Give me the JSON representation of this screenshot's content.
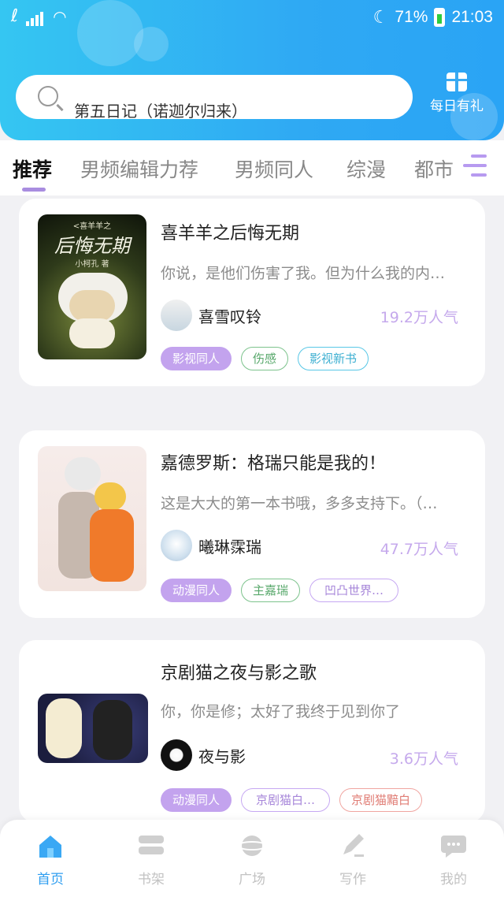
{
  "status_bar": {
    "battery": "71%",
    "time": "21:03"
  },
  "search": {
    "placeholder": "第五日记（诺迦尔归来）"
  },
  "daily_gift": {
    "label": "每日有礼"
  },
  "tabs": [
    {
      "label": "推荐",
      "active": true
    },
    {
      "label": "男频编辑力荐"
    },
    {
      "label": "男频同人"
    },
    {
      "label": "综漫"
    },
    {
      "label": "都市"
    }
  ],
  "books": [
    {
      "title": "喜羊羊之后悔无期",
      "description": "你说，是他们伤害了我。但为什么我的内…",
      "author": "喜雪叹铃",
      "popularity": "19.2万人气",
      "cover_text": {
        "top": "<喜羊羊之",
        "title": "后悔无期",
        "author": "小柯孔 著"
      },
      "tags": [
        "影视同人",
        "伤感",
        "影视新书"
      ]
    },
    {
      "title": "嘉德罗斯：格瑞只能是我的！",
      "description": "这是大大的第一本书哦，多多支持下。（…",
      "author": "曦琳霂瑞",
      "popularity": "47.7万人气",
      "tags": [
        "动漫同人",
        "主嘉瑞",
        "凹凸世界…"
      ]
    },
    {
      "title": "京剧猫之夜与影之歌",
      "description": "你，你是修；太好了我终于见到你了",
      "author": "夜与影",
      "popularity": "3.6万人气",
      "tags": [
        "动漫同人",
        "京剧猫白…",
        "京剧猫黯白"
      ]
    }
  ],
  "bottom_nav": [
    {
      "label": "首页",
      "icon": "home-icon",
      "active": true
    },
    {
      "label": "书架",
      "icon": "bookshelf-icon"
    },
    {
      "label": "广场",
      "icon": "planet-icon"
    },
    {
      "label": "写作",
      "icon": "pen-icon"
    },
    {
      "label": "我的",
      "icon": "chat-bubble-icon"
    }
  ],
  "colors": {
    "header": "#2fa9f3",
    "accent": "#c3a3ee",
    "nav_active": "#2f9ef0"
  }
}
